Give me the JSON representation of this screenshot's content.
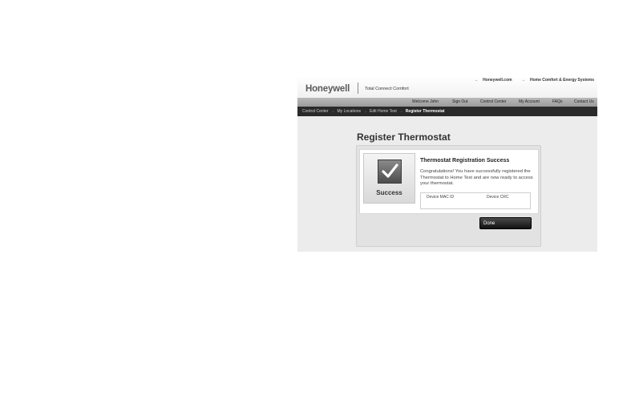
{
  "header": {
    "logo": "Honeywell",
    "tagline": "Total Connect Comfort",
    "top_links": [
      "Honeywell.com",
      "Home Comfort & Energy Systems"
    ]
  },
  "nav": {
    "welcome": "Welcome John",
    "items": [
      "Sign Out",
      "Control Center",
      "My Account",
      "FAQs",
      "Contact Us"
    ]
  },
  "breadcrumb": {
    "items": [
      "Control Center",
      "My Locations",
      "Edit Home Test"
    ],
    "current": "Register Thermostat"
  },
  "page": {
    "title": "Register Thermostat"
  },
  "card": {
    "success_label": "Success",
    "title": "Thermostat Registration Success",
    "message": "Congratulations! You have successfully registered the Thermostat to Home Test and are now ready to access your thermostat.",
    "device_mac_label": "Device MAC ID",
    "device_crc_label": "Device CRC"
  },
  "actions": {
    "done_label": "Done"
  },
  "icons": {
    "success": "checkmark-icon",
    "link_arrow": "arrow-right-icon",
    "breadcrumb_separator": "arrow-right-icon"
  }
}
